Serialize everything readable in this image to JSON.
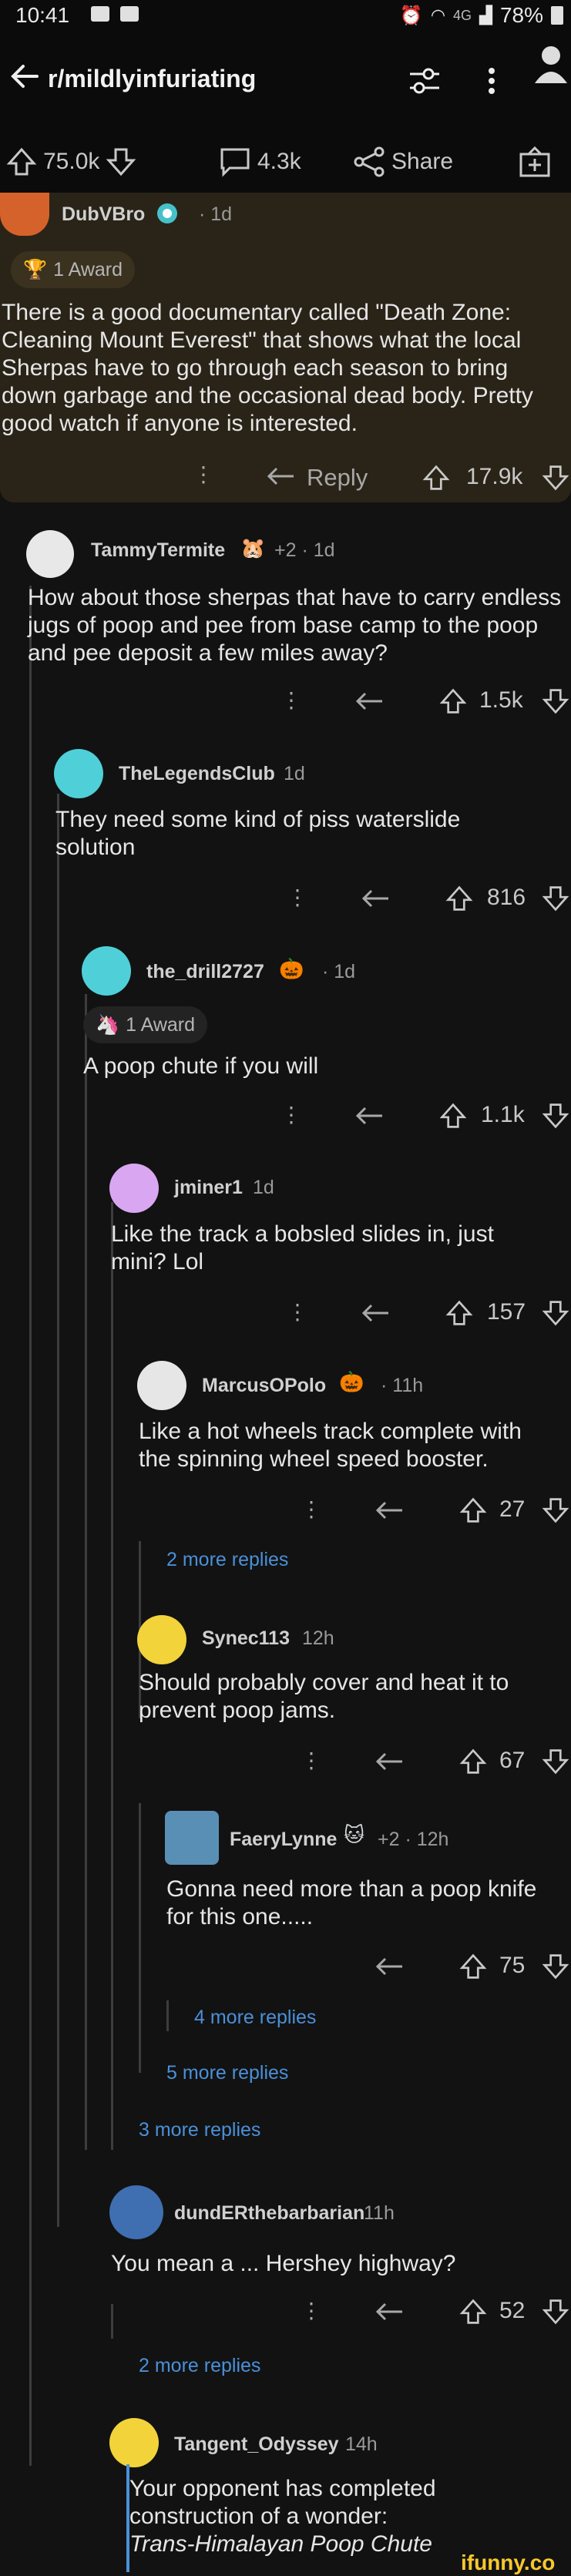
{
  "status_bar": {
    "time": "10:41",
    "network": "4G",
    "battery": "78%"
  },
  "header": {
    "subreddit": "r/mildlyinfuriating"
  },
  "post_actions": {
    "upvotes": "75.0k",
    "comments": "4.3k",
    "share_label": "Share"
  },
  "top_comment": {
    "username": "DubVBro",
    "time": "· 1d",
    "award": "1 Award",
    "body": "There is a good documentary called \"Death Zone: Cleaning Mount Everest\" that shows what the local Sherpas have to go through each season to bring down garbage and the occasional dead body.  Pretty good watch if anyone is interested.",
    "reply_label": "Reply",
    "score": "17.9k"
  },
  "comments": [
    {
      "username": "TammyTermite",
      "meta": "+2 · 1d",
      "body": "How about those sherpas that have to carry endless jugs of poop and pee from base camp to the poop and pee deposit a few miles away?",
      "score": "1.5k"
    },
    {
      "username": "TheLegendsClub",
      "meta": "1d",
      "body": "They need some kind of piss waterslide solution",
      "score": "816"
    },
    {
      "username": "the_drill2727",
      "meta": "· 1d",
      "award": "1 Award",
      "body": "A poop chute if you will",
      "score": "1.1k"
    },
    {
      "username": "jminer1",
      "meta": "1d",
      "body": "Like the track a bobsled slides in, just mini?  Lol",
      "score": "157"
    },
    {
      "username": "MarcusOPolo",
      "meta": "· 11h",
      "body": "Like a hot wheels track complete with the spinning wheel speed booster.",
      "score": "27"
    },
    {
      "username": "Synec113",
      "meta": "12h",
      "body": "Should probably cover and heat it to prevent poop jams.",
      "score": "67"
    },
    {
      "username": "FaeryLynne",
      "meta": "+2 · 12h",
      "body": "Gonna need more than a poop knife for this one.....",
      "score": "75"
    },
    {
      "username": "dundERthebarbarian",
      "meta": "11h",
      "body": "You mean a ... Hershey highway?",
      "score": "52"
    },
    {
      "username": "Tangent_Odyssey",
      "meta": "14h",
      "body_lines": [
        "Your opponent has completed",
        "construction of a wonder:",
        "Trans-Himalayan Poop Chute"
      ]
    }
  ],
  "more_replies": {
    "marcus": "2 more replies",
    "faery": "4 more replies",
    "synec": "5 more replies",
    "jminer": "3 more replies",
    "dunder": "2 more replies"
  },
  "watermark": "ifunny.co",
  "colors": {
    "background": "#121212",
    "link": "#4a90d9",
    "top_comment_bg": "#2a2418"
  }
}
